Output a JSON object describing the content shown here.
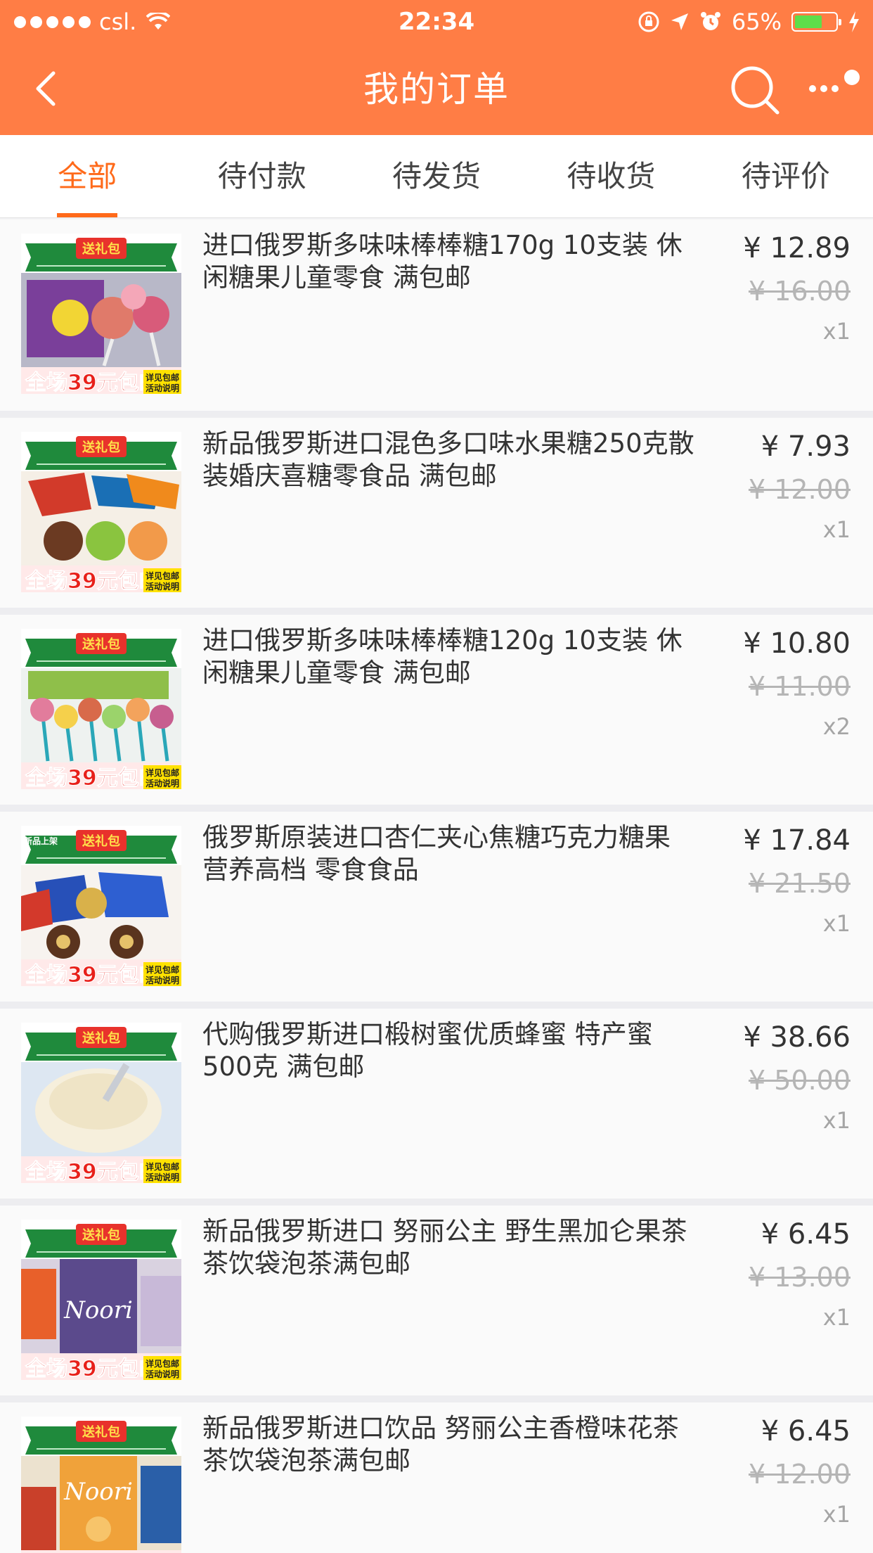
{
  "status_bar": {
    "carrier": "csl.",
    "time": "22:34",
    "battery": "65%",
    "battery_level": 0.65
  },
  "header": {
    "title": "我的订单",
    "back_icon": "chevron-left-icon",
    "search_icon": "search-icon",
    "more_icon": "more-icon"
  },
  "tabs": [
    {
      "label": "全部",
      "active": true
    },
    {
      "label": "待付款",
      "active": false
    },
    {
      "label": "待发货",
      "active": false
    },
    {
      "label": "待收货",
      "active": false
    },
    {
      "label": "待评价",
      "active": false
    }
  ],
  "products": [
    {
      "name": "进口俄罗斯多味味棒棒糖170g 10支装 休闲糖果儿童零食 满包邮",
      "price": "¥ 12.89",
      "original_price": "¥ 16.00",
      "qty": "x1"
    },
    {
      "name": "新品俄罗斯进口混色多口味水果糖250克散装婚庆喜糖零食品 满包邮",
      "price": "¥ 7.93",
      "original_price": "¥ 12.00",
      "qty": "x1"
    },
    {
      "name": "进口俄罗斯多味味棒棒糖120g 10支装 休闲糖果儿童零食 满包邮",
      "price": "¥ 10.80",
      "original_price": "¥ 11.00",
      "qty": "x2"
    },
    {
      "name": "俄罗斯原装进口杏仁夹心焦糖巧克力糖果 营养高档 零食食品",
      "price": "¥ 17.84",
      "original_price": "¥ 21.50",
      "qty": "x1"
    },
    {
      "name": "代购俄罗斯进口椴树蜜优质蜂蜜 特产蜜500克 满包邮",
      "price": "¥ 38.66",
      "original_price": "¥ 50.00",
      "qty": "x1"
    },
    {
      "name": "新品俄罗斯进口 努丽公主 野生黑加仑果茶 茶饮袋泡茶满包邮",
      "price": "¥ 6.45",
      "original_price": "¥ 13.00",
      "qty": "x1"
    },
    {
      "name": "新品俄罗斯进口饮品 努丽公主香橙味花茶茶饮袋泡茶满包邮",
      "price": "¥ 6.45",
      "original_price": "¥ 12.00",
      "qty": "x1"
    }
  ],
  "thumb_banner": {
    "top": "送礼包",
    "bottom": "全场39元包邮",
    "side": "详见包邮活动说明",
    "new_tag": "新品上架",
    "brand": "Noori"
  },
  "colors": {
    "accent": "#ff7d45",
    "tab_active": "#ff6a1a"
  }
}
